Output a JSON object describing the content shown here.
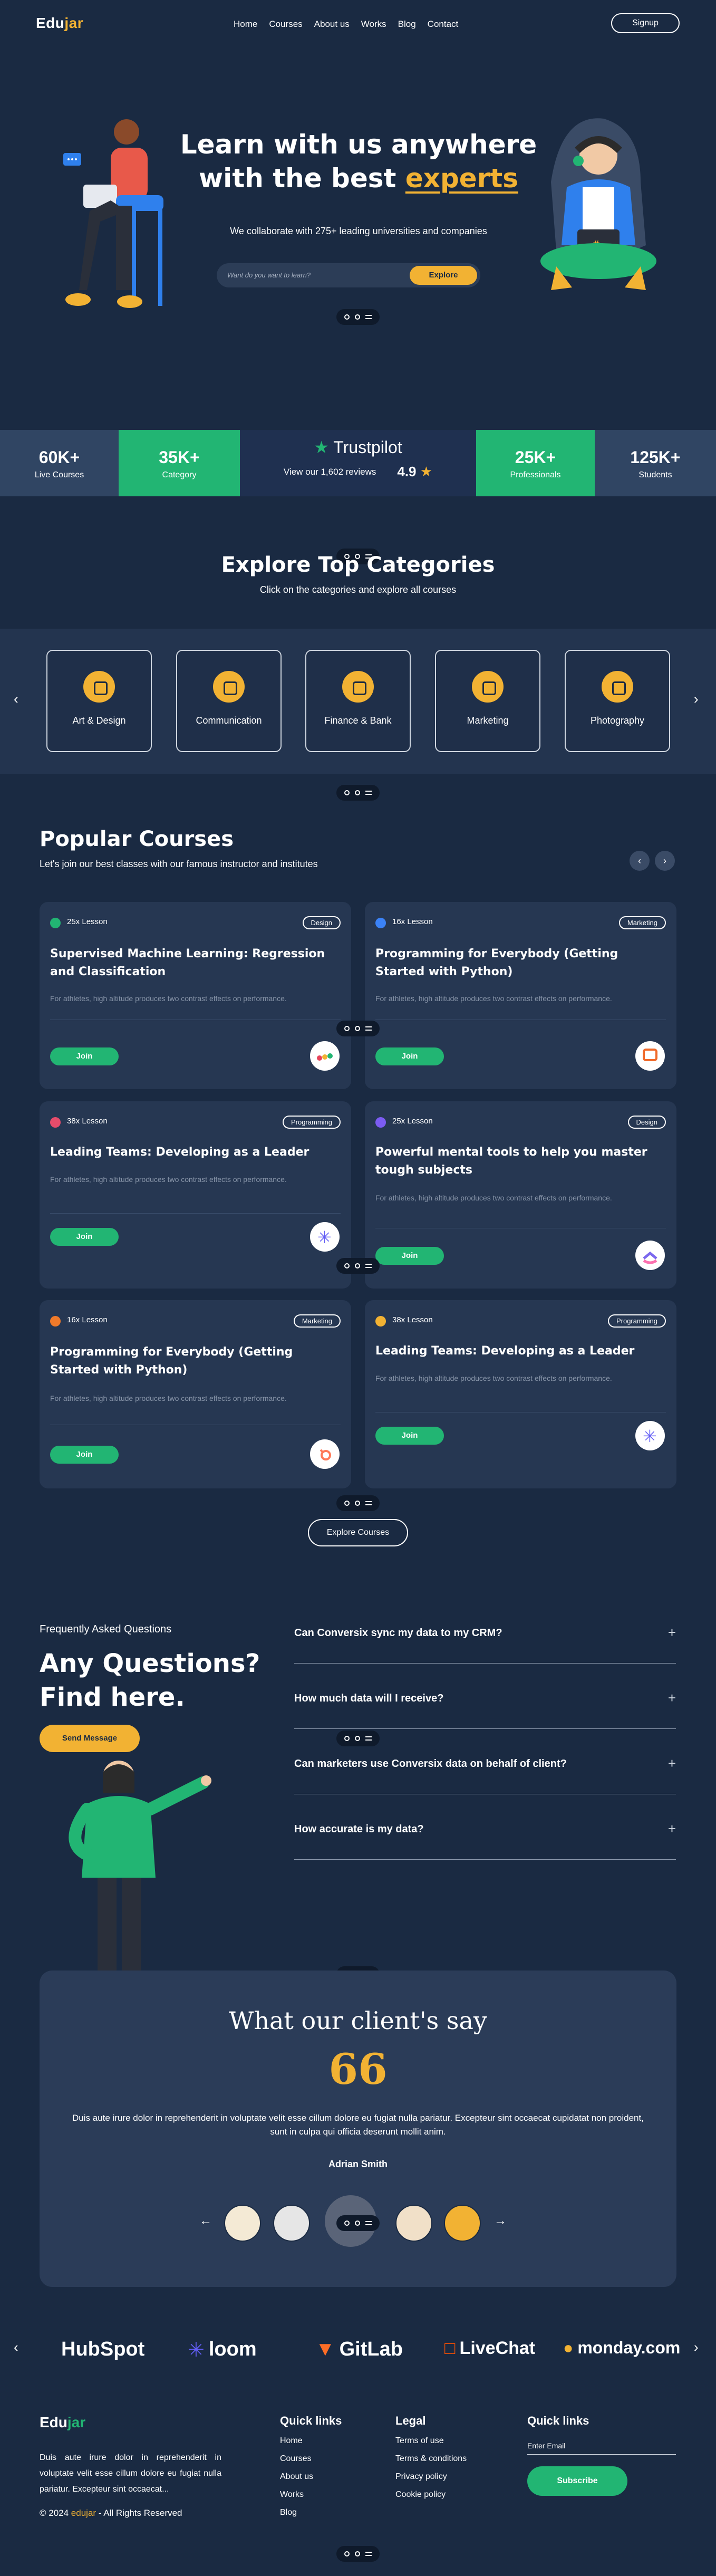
{
  "nav": {
    "logo_main": "Edu",
    "logo_accent": "jar",
    "items": [
      "Home",
      "Courses",
      "About us",
      "Works",
      "Blog",
      "Contact"
    ],
    "signup": "Signup"
  },
  "hero": {
    "title_line1": "Learn with us anywhere",
    "title_line2_prefix": "with the best ",
    "title_highlight": "experts",
    "subtitle": "We collaborate with 275+ leading universities and companies",
    "search_placeholder": "Want do you want to learn?",
    "search_button": "Explore"
  },
  "stats": {
    "live_courses": {
      "value": "60K+",
      "label": "Live Courses"
    },
    "category": {
      "value": "35K+",
      "label": "Category"
    },
    "trustpilot": {
      "brand": "Trustpilot",
      "reviews": "View our 1,602 reviews",
      "rating": "4.9"
    },
    "professionals": {
      "value": "25K+",
      "label": "Professionals"
    },
    "students": {
      "value": "125K+",
      "label": "Students"
    }
  },
  "categories": {
    "title": "Explore Top Categories",
    "subtitle": "Click on the categories and explore all courses",
    "items": [
      "Art & Design",
      "Communication",
      "Finance & Bank",
      "Marketing",
      "Photography"
    ]
  },
  "courses": {
    "title": "Popular Courses",
    "subtitle": "Let's join our best classes with our famous instructor and institutes",
    "join_label": "Join",
    "description": "For athletes, high altitude produces two contrast effects on performance.",
    "explore_button": "Explore Courses",
    "items": [
      {
        "lesson": "25x Lesson",
        "tag": "Design",
        "title": "Supervised Machine Learning: Regression and Classification",
        "icon_color": "#22b573"
      },
      {
        "lesson": "16x Lesson",
        "tag": "Marketing",
        "title": "Programming for Everybody (Getting Started with Python)",
        "icon_color": "#3b82f6"
      },
      {
        "lesson": "38x Lesson",
        "tag": "Programming",
        "title": "Leading Teams: Developing as a Leader",
        "icon_color": "#e74c6b"
      },
      {
        "lesson": "25x Lesson",
        "tag": "Design",
        "title": "Powerful mental tools to help you master tough subjects",
        "icon_color": "#7c5cf2"
      },
      {
        "lesson": "16x Lesson",
        "tag": "Marketing",
        "title": "Programming for Everybody (Getting Started with Python)",
        "icon_color": "#f07a2a"
      },
      {
        "lesson": "38x Lesson",
        "tag": "Programming",
        "title": "Leading Teams: Developing as a Leader",
        "icon_color": "#f2b233"
      }
    ]
  },
  "faq": {
    "kicker": "Frequently Asked Questions",
    "title_line1": "Any Questions?",
    "title_line2": "Find here.",
    "button": "Send Message",
    "questions": [
      "Can Conversix sync my data to my CRM?",
      "How much data will I receive?",
      "Can marketers use Conversix data on behalf of client?",
      "How accurate is my data?"
    ]
  },
  "testimonial": {
    "title": "What our client's say",
    "quote_mark": "66",
    "text": "Duis aute irure dolor in reprehenderit in voluptate velit esse cillum dolore eu fugiat nulla pariatur. Excepteur sint occaecat cupidatat non proident, sunt in culpa qui officia deserunt mollit anim.",
    "author": "Adrian Smith"
  },
  "partners": [
    "HubSpot",
    "loom",
    "GitLab",
    "LiveChat",
    "monday.com"
  ],
  "footer": {
    "logo_main": "Edu",
    "logo_accent": "jar",
    "about": "Duis aute irure dolor in reprehenderit in voluptate velit esse cillum dolore eu fugiat nulla pariatur. Excepteur sint occaecat...",
    "copyright_prefix": "© 2024 ",
    "copyright_brand": "edujar",
    "copyright_suffix": " - All Rights Reserved",
    "quick_links_title": "Quick links",
    "quick_links": [
      "Home",
      "Courses",
      "About us",
      "Works",
      "Blog"
    ],
    "legal_title": "Legal",
    "legal": [
      "Terms of use",
      "Terms & conditions",
      "Privacy policy",
      "Cookie policy"
    ],
    "newsletter_title": "Quick links",
    "email_placeholder": "Enter Email",
    "subscribe": "Subscribe"
  },
  "colors": {
    "background": "#1a2a42",
    "accent_yellow": "#f2b233",
    "accent_green": "#22b573"
  }
}
